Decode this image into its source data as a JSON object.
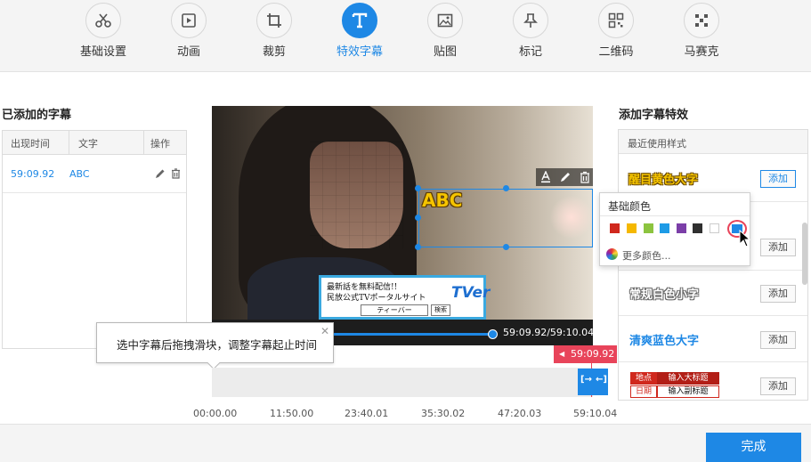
{
  "toolbar": {
    "items": [
      {
        "label": "基础设置",
        "icon": "scissors-icon"
      },
      {
        "label": "动画",
        "icon": "animation-icon"
      },
      {
        "label": "裁剪",
        "icon": "crop-icon"
      },
      {
        "label": "特效字幕",
        "icon": "text-icon"
      },
      {
        "label": "贴图",
        "icon": "image-icon"
      },
      {
        "label": "标记",
        "icon": "pin-icon"
      },
      {
        "label": "二维码",
        "icon": "qrcode-icon"
      },
      {
        "label": "马赛克",
        "icon": "mosaic-icon"
      }
    ],
    "active_index": 3
  },
  "left_panel": {
    "title": "已添加的字幕",
    "columns": [
      "出现时间",
      "文字",
      "操作"
    ],
    "rows": [
      {
        "time": "59:09.92",
        "text": "ABC"
      }
    ]
  },
  "video": {
    "caption_text": "ABC",
    "banner": {
      "line1": "最新話を無料配信!!",
      "line2": "民放公式TVポータルサイト",
      "logo": "TVer",
      "button": "ティーバー",
      "search": "検索"
    },
    "time_display": "59:09.92/59:10.04"
  },
  "tooltip": {
    "text": "选中字幕后拖拽滑块，调整字幕起止时间"
  },
  "timeline": {
    "marker_time": "59:09.92",
    "ticks": [
      "00:00.00",
      "11:50.00",
      "23:40.01",
      "35:30.02",
      "47:20.03",
      "59:10.04"
    ]
  },
  "right_panel": {
    "title": "添加字幕特效",
    "recent_header": "最近使用样式",
    "add_label": "添加",
    "styles": [
      {
        "name": "醒目黄色大字",
        "color": "#f5c400"
      },
      {
        "name": "常规白色小字",
        "color": "#ffffff"
      },
      {
        "name": "清爽蓝色大字",
        "color": "#1e88e5"
      }
    ],
    "news_style": {
      "place_label": "地点",
      "title_label": "输入大标题",
      "date_label": "日期",
      "subtitle_label": "输入副标题"
    }
  },
  "color_popup": {
    "title": "基础颜色",
    "swatches": [
      "#d0281d",
      "#f5b800",
      "#8cc43f",
      "#1e9be6",
      "#7b3ea8",
      "#303030",
      "#ffffff",
      "#1e88e5"
    ],
    "more_label": "更多颜色..."
  },
  "footer": {
    "done_label": "完成"
  }
}
